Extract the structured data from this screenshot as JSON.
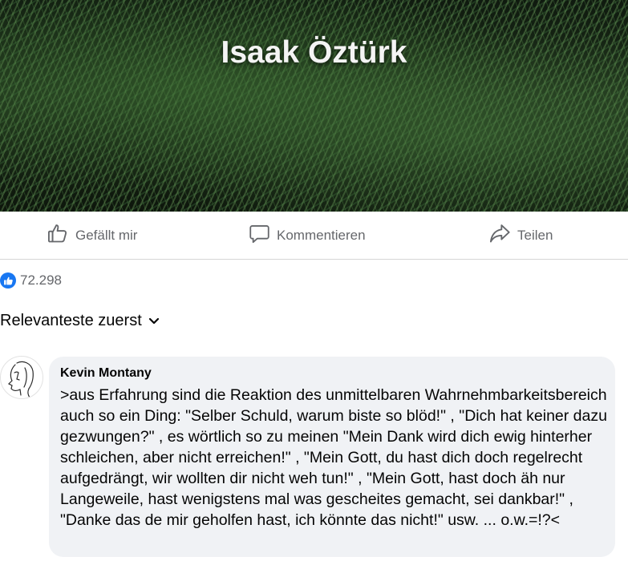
{
  "post": {
    "cover_title": "Isaak Öztürk"
  },
  "actions": {
    "like_label": "Gefällt mir",
    "comment_label": "Kommentieren",
    "share_label": "Teilen"
  },
  "reactions": {
    "count": "72.298",
    "icon": "thumbs-up-icon",
    "color": "#1877f2"
  },
  "comments": {
    "sort_label": "Relevanteste zuerst",
    "items": [
      {
        "author": "Kevin Montany",
        "text": ">aus Erfahrung sind die Reaktion des unmittelbaren Wahrnehmbarkeitsbereich auch so ein Ding: \"Selber Schuld, warum biste so blöd!\" , \"Dich hat keiner dazu gezwungen?\" , es wörtlich so zu meinen \"Mein Dank wird dich ewig hinterher schleichen, aber nicht erreichen!\" , \"Mein Gott, du hast dich doch regelrecht aufgedrängt, wir wollten dir nicht weh tun!\" , \"Mein Gott, hast doch äh nur Langeweile, hast wenigstens mal was gescheites gemacht, sei dankbar!\" , \"Danke das de mir geholfen hast, ich könnte das nicht!\" usw. ... o.w.=!?<"
      }
    ]
  },
  "colors": {
    "secondary_text": "#65676b",
    "bubble_bg": "#f0f2f5"
  }
}
